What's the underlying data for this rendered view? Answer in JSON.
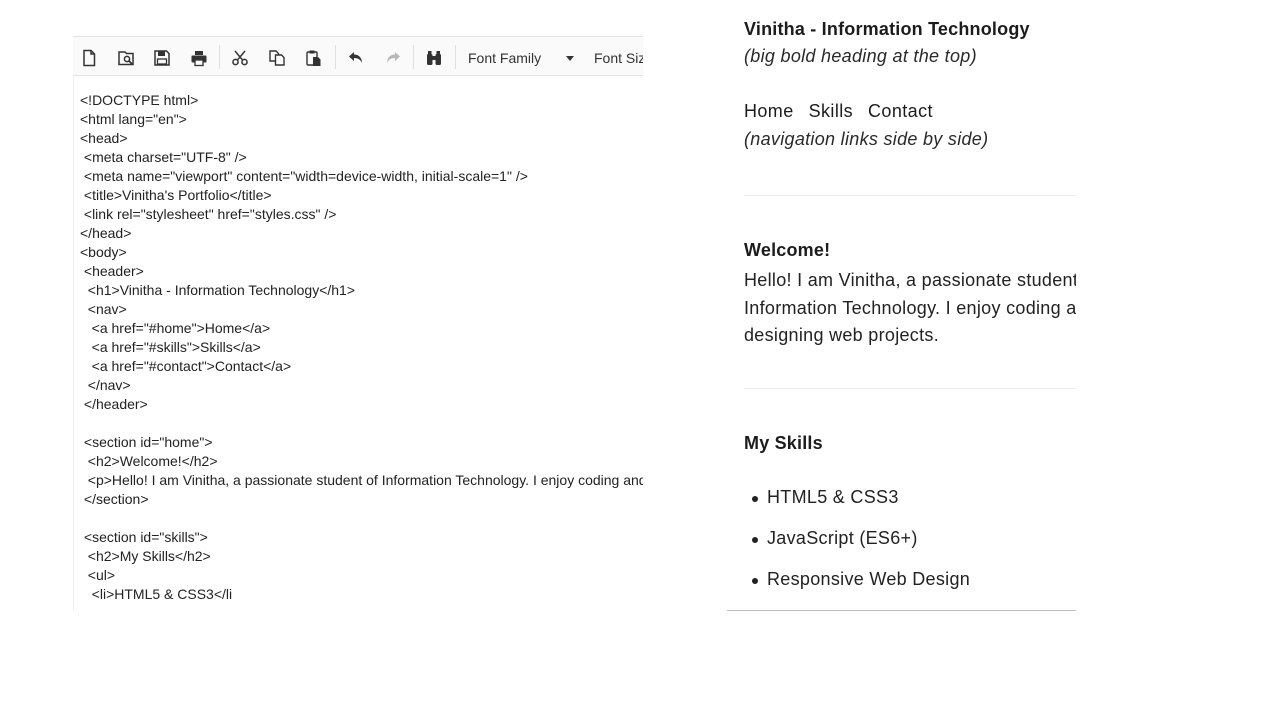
{
  "toolbar": {
    "font_family_label": "Font Family",
    "font_size_label": "Font Size",
    "icons": [
      "new-document-icon",
      "print-preview-icon",
      "save-icon",
      "print-icon",
      "cut-icon",
      "copy-icon",
      "paste-icon",
      "undo-icon",
      "redo-icon",
      "find-icon"
    ]
  },
  "code_lines": [
    "<!DOCTYPE html>",
    "<html lang=\"en\">",
    "<head>",
    " <meta charset=\"UTF-8\" />",
    " <meta name=\"viewport\" content=\"width=device-width, initial-scale=1\" />",
    " <title>Vinitha's Portfolio</title>",
    " <link rel=\"stylesheet\" href=\"styles.css\" />",
    "</head>",
    "<body>",
    " <header>",
    "  <h1>Vinitha - Information Technology</h1>",
    "  <nav>",
    "   <a href=\"#home\">Home</a>",
    "   <a href=\"#skills\">Skills</a>",
    "   <a href=\"#contact\">Contact</a>",
    "  </nav>",
    " </header>",
    "",
    " <section id=\"home\">",
    "  <h2>Welcome!</h2>",
    "  <p>Hello! I am Vinitha, a passionate student of Information Technology. I enjoy coding and designing web projects.</p>",
    " </section>",
    "",
    " <section id=\"skills\">",
    "  <h2>My Skills</h2>",
    "  <ul>",
    "   <li>HTML5 & CSS3</li"
  ],
  "preview": {
    "title": "Vinitha - Information Technology",
    "title_note": "(big bold heading at the top)",
    "nav_links": [
      "Home",
      "Skills",
      "Contact"
    ],
    "nav_note": "(navigation links side by side)",
    "welcome_heading": "Welcome!",
    "welcome_lines": [
      "Hello! I am Vinitha, a passionate student of",
      "Information Technology. I enjoy coding and",
      "designing web projects."
    ],
    "skills_heading": "My Skills",
    "skills": [
      "HTML5 & CSS3",
      "JavaScript (ES6+)",
      "Responsive Web Design"
    ]
  }
}
